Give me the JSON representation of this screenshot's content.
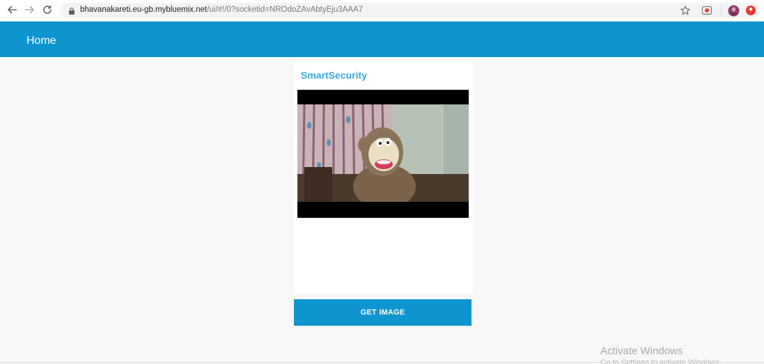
{
  "browser": {
    "url_host": "bhavanakareti.eu-gb.mybluemix.net",
    "url_path": "/ui/#!/0?socketid=NROdoZAvAbtyEju3AAA7",
    "back_icon": "arrow-left-icon",
    "forward_icon": "arrow-right-icon",
    "reload_icon": "reload-icon",
    "lock_icon": "lock-icon",
    "star_icon": "star-icon",
    "colors": {
      "ext_red": "#e53935",
      "avatar": "#8e3b6e"
    }
  },
  "header": {
    "title": "Home",
    "color": "#0e95cf"
  },
  "card": {
    "title": "SmartSecurity",
    "video_alt": "webcam snapshot of a plush monkey toy"
  },
  "actions": {
    "get_image_label": "GET IMAGE"
  },
  "watermark": {
    "title": "Activate Windows",
    "subtitle": "Go to Settings to activate Windows."
  }
}
